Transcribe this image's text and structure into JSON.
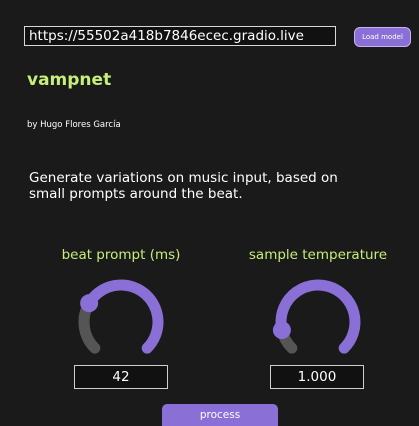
{
  "header": {
    "url_value": "https://55502a418b7846ecec.gradio.live",
    "load_button_label": "Load model"
  },
  "app": {
    "title": "vampnet",
    "byline": "by Hugo Flores García",
    "description": "Generate variations on music input, based on small prompts around the beat."
  },
  "controls": {
    "beat_prompt": {
      "label": "beat prompt (ms)",
      "value": "42",
      "level": 0.28
    },
    "sample_temperature": {
      "label": "sample temperature",
      "value": "1.000",
      "level": 0.12
    }
  },
  "actions": {
    "process_label": "process"
  },
  "colors": {
    "background": "#1a1a1a",
    "accent": "#8a6fd6",
    "title": "#c5ee7a",
    "knob_track": "#555555"
  }
}
